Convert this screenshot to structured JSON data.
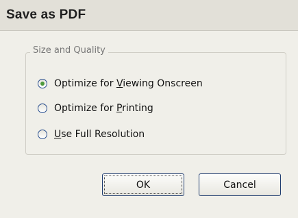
{
  "dialog": {
    "title": "Save as PDF",
    "group_label": "Size and Quality",
    "options": [
      {
        "pre": "Optimize for ",
        "accel": "V",
        "post": "iewing Onscreen",
        "selected": true
      },
      {
        "pre": "Optimize for ",
        "accel": "P",
        "post": "rinting",
        "selected": false
      },
      {
        "pre": "",
        "accel": "U",
        "post": "se Full Resolution",
        "selected": false
      }
    ],
    "ok_label": "OK",
    "cancel_label": "Cancel"
  },
  "colors": {
    "title_bar": "#e2e0d8",
    "radio_selected_dot": "#4e9a3c",
    "button_border": "#1f3c6f"
  }
}
